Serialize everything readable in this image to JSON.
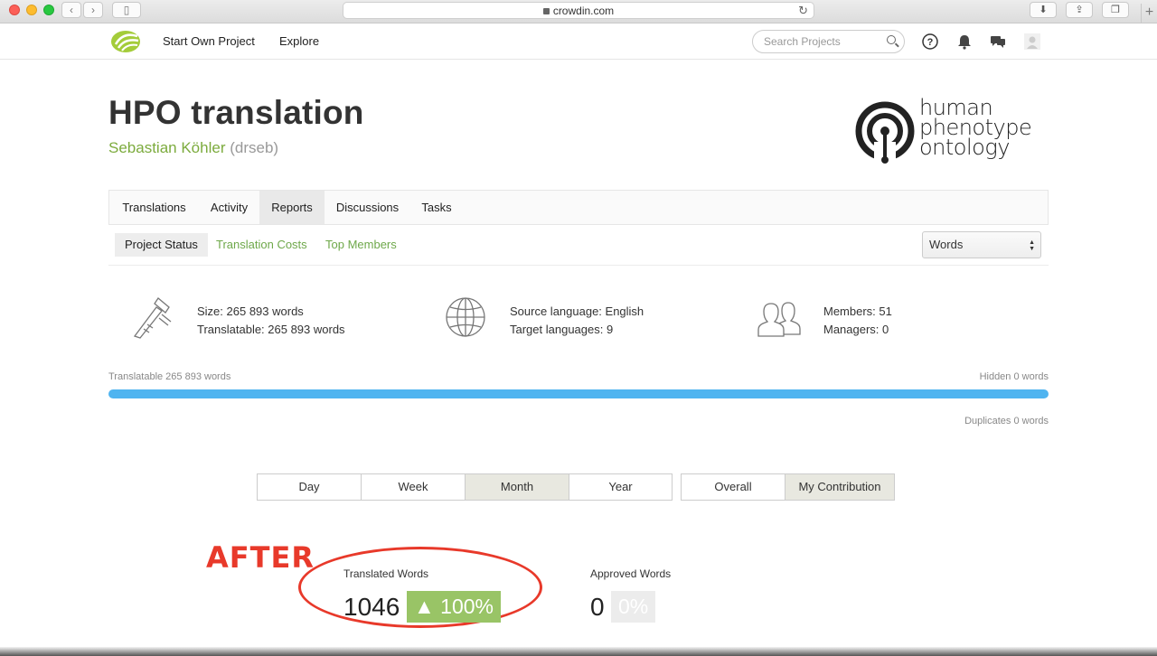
{
  "browser": {
    "url": "crowdin.com",
    "back_icon": "chevron-left-icon",
    "forward_icon": "chevron-right-icon"
  },
  "header": {
    "nav": [
      "Start Own Project",
      "Explore"
    ],
    "search_placeholder": "Search Projects"
  },
  "project": {
    "title": "HPO translation",
    "owner_name": "Sebastian Köhler",
    "owner_user": "(drseb)",
    "logo_lines": [
      "human",
      "phenotype",
      "ontology"
    ]
  },
  "tabs": [
    "Translations",
    "Activity",
    "Reports",
    "Discussions",
    "Tasks"
  ],
  "active_tab": "Reports",
  "subtabs": [
    "Project Status",
    "Translation Costs",
    "Top Members"
  ],
  "unit_select": "Words",
  "stats": {
    "size": "Size: 265 893 words",
    "translatable": "Translatable: 265 893 words",
    "source_language": "Source language: English",
    "target_languages": "Target languages: 9",
    "members": "Members: 51",
    "managers": "Managers: 0"
  },
  "progress": {
    "left_label": "Translatable 265 893 words",
    "right_label": "Hidden 0 words",
    "duplicates_label": "Duplicates 0 words",
    "translatable_fraction": 1.0
  },
  "period_buttons": [
    "Day",
    "Week",
    "Month",
    "Year"
  ],
  "scope_buttons": [
    "Overall",
    "My Contribution"
  ],
  "annotation": "AFTER",
  "metrics": {
    "translated_label": "Translated Words",
    "translated_value": "1046",
    "translated_pct": "▲ 100%",
    "approved_label": "Approved Words",
    "approved_value": "0",
    "approved_pct": "0%"
  },
  "colors": {
    "accent_green": "#7cab3d",
    "progress_blue": "#4fb4f0",
    "annotation_red": "#e8392a"
  }
}
